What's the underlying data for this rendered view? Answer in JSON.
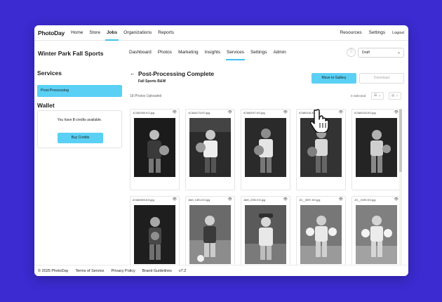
{
  "app": {
    "logo": "PhotoDay",
    "nav": [
      "Home",
      "Store",
      "Jobs",
      "Organizations",
      "Reports"
    ],
    "nav_active": "Jobs",
    "right_nav": [
      "Resources",
      "Settings",
      "Logout"
    ]
  },
  "job": {
    "title": "Winter Park Fall Sports",
    "tabs": [
      "Dashboard",
      "Photos",
      "Marketing",
      "Insights",
      "Services",
      "Settings",
      "Admin"
    ],
    "active_tab": "Services",
    "status_value": "Draft",
    "info_icon": "info-icon"
  },
  "sidebar": {
    "title": "Services",
    "items": [
      {
        "label": "Post-Processing"
      }
    ],
    "wallet_title": "Wallet",
    "wallet_text_before": "You have ",
    "wallet_credits": "0",
    "wallet_text_after": " credits available.",
    "buy_label": "Buy Credits"
  },
  "main": {
    "title": "Post-Processing Complete",
    "subtitle": "Fall Sports B&W",
    "move_label": "Move to Gallery",
    "download_label": "Download",
    "photo_count": "18 Photos Uploaded",
    "selected": "0 Selected"
  },
  "photos": [
    {
      "name": "1C3A0050-KO.jpg"
    },
    {
      "name": "1C3A4173-KO.jpg"
    },
    {
      "name": "A7A60047-KO.jpg"
    },
    {
      "name": "A7A60116-KO.jpg"
    },
    {
      "name": "A7A60153-KO.jpg"
    },
    {
      "name": "A7A60309-KO.jpg"
    },
    {
      "name": "JAM_1391-KO.jpg"
    },
    {
      "name": "JAM_2292-KO.jpg"
    },
    {
      "name": "JO__0097-KO.jpg"
    },
    {
      "name": "JO__0199-KO.jpg"
    }
  ],
  "footer": {
    "copyright": "© 2025 PhotoDay",
    "links": [
      "Terms of Service",
      "Privacy Policy",
      "Brand Guidelines"
    ],
    "version": "v7.2"
  },
  "colors": {
    "background": "#3b2bd0",
    "accent": "#5ad0f5"
  }
}
